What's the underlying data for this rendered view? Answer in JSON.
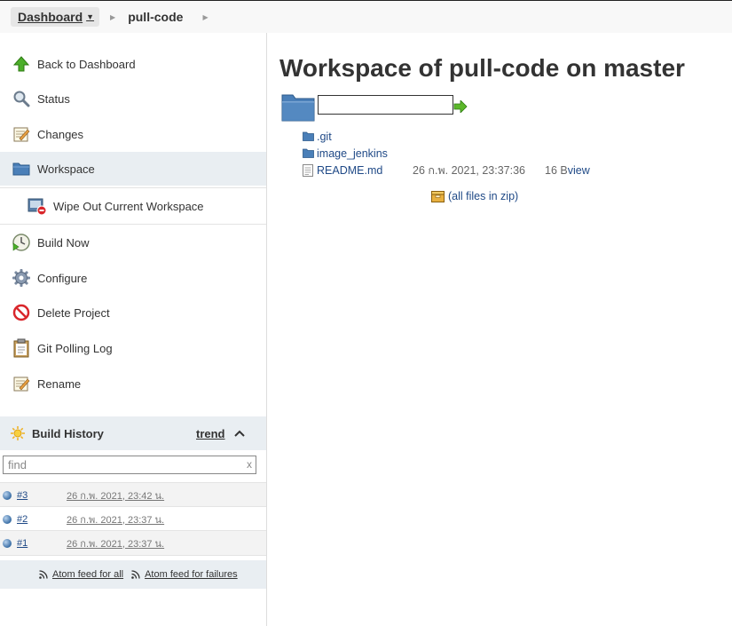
{
  "breadcrumb": {
    "dashboard": "Dashboard",
    "job": "pull-code"
  },
  "sidebar": {
    "tasks": [
      {
        "label": "Back to Dashboard",
        "icon": "up-arrow-icon"
      },
      {
        "label": "Status",
        "icon": "magnifier-icon"
      },
      {
        "label": "Changes",
        "icon": "notepad-icon"
      },
      {
        "label": "Workspace",
        "icon": "folder-icon"
      },
      {
        "label": "Wipe Out Current Workspace",
        "icon": "wipe-workspace-icon"
      },
      {
        "label": "Build Now",
        "icon": "clock-play-icon"
      },
      {
        "label": "Configure",
        "icon": "gear-icon"
      },
      {
        "label": "Delete Project",
        "icon": "no-entry-icon"
      },
      {
        "label": "Git Polling Log",
        "icon": "clipboard-icon"
      },
      {
        "label": "Rename",
        "icon": "notepad-icon"
      }
    ]
  },
  "build_history": {
    "title": "Build History",
    "trend": "trend",
    "find_placeholder": "find",
    "find_clear": "x",
    "builds": [
      {
        "number": "#3",
        "date": "26 ก.พ. 2021, 23:42 น."
      },
      {
        "number": "#2",
        "date": "26 ก.พ. 2021, 23:37 น."
      },
      {
        "number": "#1",
        "date": "26 ก.พ. 2021, 23:37 น."
      }
    ],
    "feed_all": "Atom feed for all",
    "feed_failures": "Atom feed for failures"
  },
  "workspace": {
    "title": "Workspace of pull-code on master",
    "path_value": "",
    "entries": [
      {
        "name": ".git",
        "type": "folder",
        "date": "",
        "size": "",
        "view": ""
      },
      {
        "name": "image_jenkins",
        "type": "folder",
        "date": "",
        "size": "",
        "view": ""
      },
      {
        "name": "README.md",
        "type": "file",
        "date": "26 ก.พ. 2021, 23:37:36",
        "size": "16 B",
        "view": "view"
      }
    ],
    "zip_label": "(all files in zip)"
  },
  "colors": {
    "link": "#204a87",
    "sidebar_active": "#e9eef2",
    "breadcrumb_bg": "#f8f8f8"
  }
}
